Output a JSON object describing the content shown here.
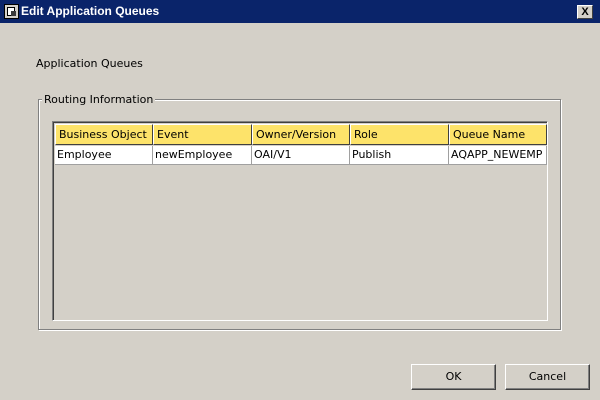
{
  "window": {
    "title": "Edit Application Queues",
    "close_label": "X"
  },
  "main": {
    "section_label": "Application Queues",
    "group_label": "Routing Information"
  },
  "table": {
    "columns": [
      "Business Object",
      "Event",
      "Owner/Version",
      "Role",
      "Queue Name"
    ],
    "rows": [
      [
        "Employee",
        "newEmployee",
        "OAI/V1",
        "Publish",
        "AQAPP_NEWEMP"
      ]
    ]
  },
  "footer": {
    "ok_label": "OK",
    "cancel_label": "Cancel"
  },
  "colors": {
    "title_bar": "#0a246a",
    "window_bg": "#d4d0c8",
    "header_bg": "#fde36a"
  }
}
